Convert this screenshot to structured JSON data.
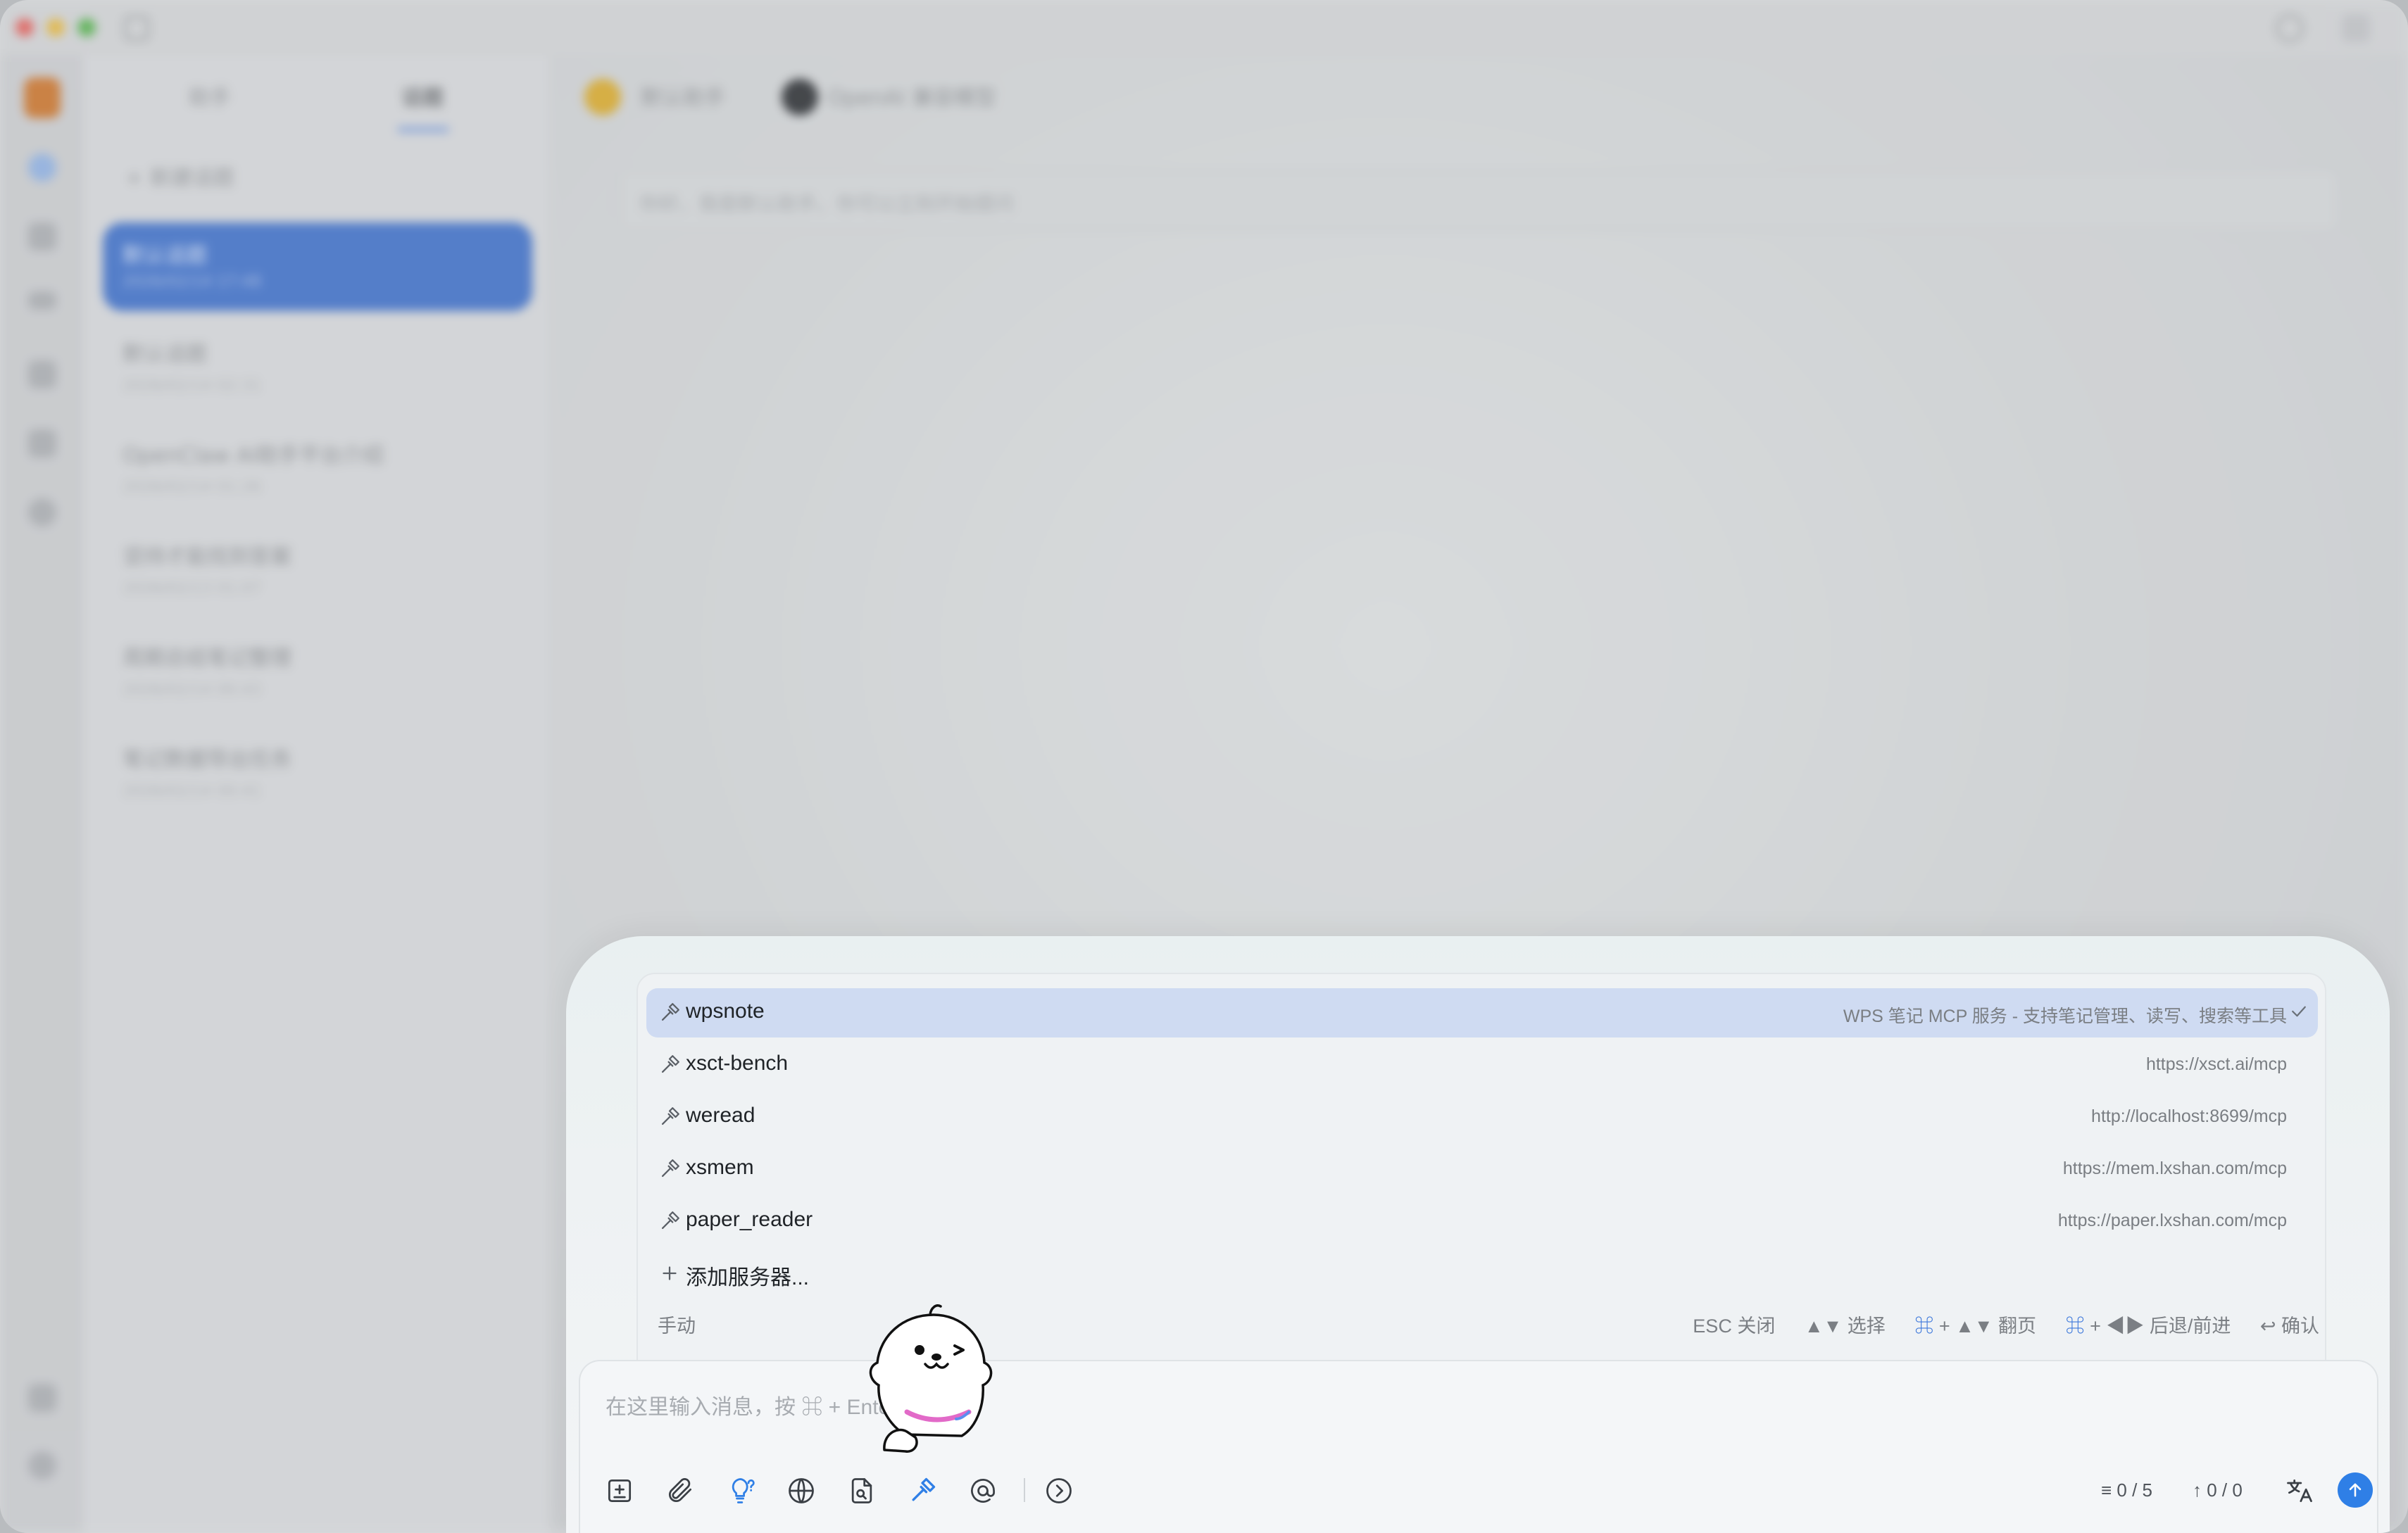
{
  "background": {
    "tabs": [
      "助手",
      "话题"
    ],
    "new_topic": "新建话题",
    "topics": [
      {
        "title": "默认话题",
        "time": "2026/02/14 17:48"
      },
      {
        "title": "默认话题",
        "time": "2026/02/14 02:31"
      },
      {
        "title": "OpenClaw AI助手平台介绍",
        "time": "2026/02/14 01:26"
      },
      {
        "title": "坚持才能找到答案",
        "time": "2026/02/13 01:07"
      },
      {
        "title": "周期总结笔记整理",
        "time": "2026/02/14 00:43"
      },
      {
        "title": "笔记数据导出任务",
        "time": "2026/02/14 00:41"
      }
    ],
    "breadcrumb": [
      "默认助手",
      "OpenAI 兼容模型"
    ],
    "welcome": "你好，我是默认助手。你可以立刻开始提问"
  },
  "mcp_menu": {
    "servers": [
      {
        "name": "wpsnote",
        "desc": "WPS 笔记 MCP 服务 - 支持笔记管理、读写、搜索等工具",
        "selected": true
      },
      {
        "name": "xsct-bench",
        "desc": "https://xsct.ai/mcp",
        "selected": false
      },
      {
        "name": "weread",
        "desc": "http://localhost:8699/mcp",
        "selected": false
      },
      {
        "name": "xsmem",
        "desc": "https://mem.lxshan.com/mcp",
        "selected": false
      },
      {
        "name": "paper_reader",
        "desc": "https://paper.lxshan.com/mcp",
        "selected": false
      }
    ],
    "add_server": "添加服务器...",
    "mode": "手动",
    "hints": {
      "esc": "ESC 关闭",
      "select": "▲▼ 选择",
      "page_key": "⌘",
      "page": "+ ▲▼ 翻页",
      "nav_key": "⌘",
      "nav": "+ ◀▶ 后退/前进",
      "confirm": "↩ 确认"
    }
  },
  "composer": {
    "placeholder": "在这里输入消息，按 ⌘ + Enter 发送",
    "context_count": "0 / 5",
    "token_count": "0 / 0"
  },
  "colors": {
    "accent": "#2f7fe6",
    "selected_row": "#cfdbf2"
  }
}
